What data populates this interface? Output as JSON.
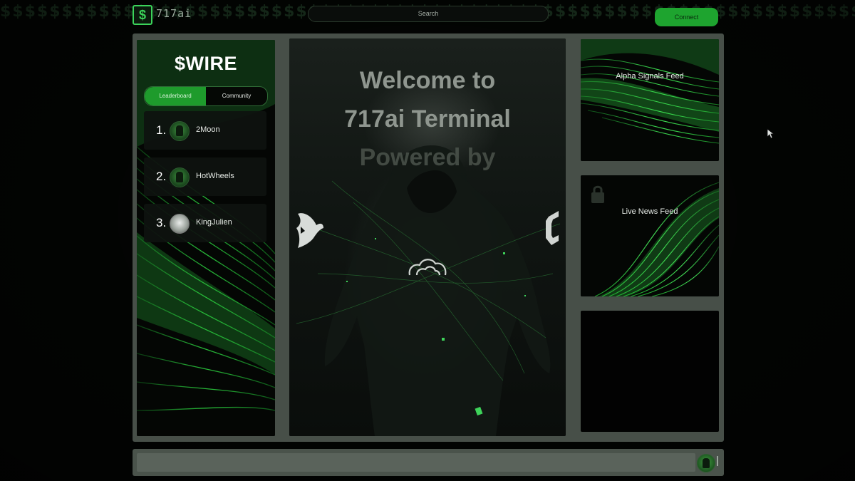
{
  "app": {
    "logo_icon": "dollar-icon",
    "logo_glyph": "$",
    "name": "717ai"
  },
  "header": {
    "search_placeholder": "Search",
    "connect_label": "Connect"
  },
  "left_panel": {
    "token": "$WIRE",
    "tabs": [
      {
        "label": "Leaderboard",
        "active": true
      },
      {
        "label": "Community",
        "active": false
      }
    ],
    "leaderboard": [
      {
        "rank": "1.",
        "name": "2Moon",
        "avatar": "green-avatar"
      },
      {
        "rank": "2.",
        "name": "HotWheels",
        "avatar": "green-avatar"
      },
      {
        "rank": "3.",
        "name": "KingJulien",
        "avatar": "gray-avatar"
      }
    ]
  },
  "center": {
    "line1": "Welcome to",
    "line2": "717ai Terminal",
    "line3": "Powered by",
    "logos": [
      "shark-logo",
      "cloud-logo",
      "bracket-logo"
    ]
  },
  "right_panels": {
    "alpha_label": "Alpha Signals Feed",
    "news_label": "Live News Feed",
    "news_icon": "lock-icon"
  },
  "bottom": {
    "avatar": "green-avatar"
  },
  "colors": {
    "accent": "#1ea42f",
    "glow": "#3bd35a",
    "background": "#030503",
    "frame": "#474f48"
  },
  "bg_pattern_glyph": "$"
}
